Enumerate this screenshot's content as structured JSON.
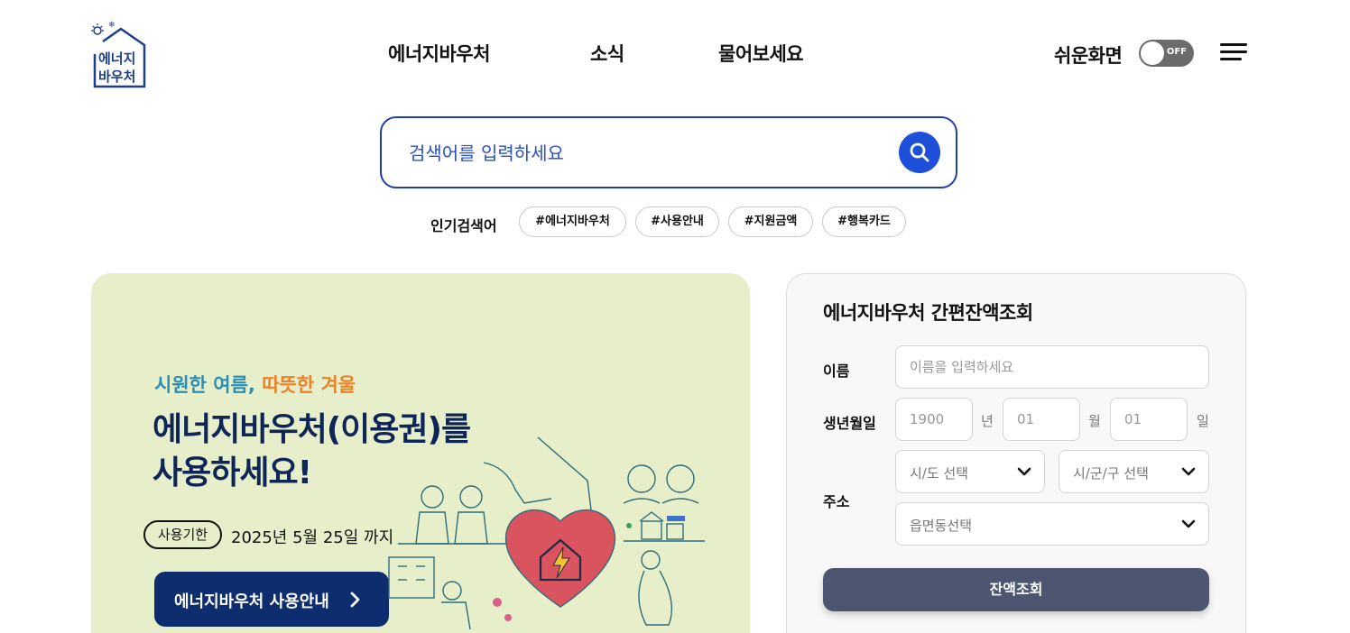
{
  "header": {
    "logo_text_line1": "에너지",
    "logo_text_line2": "바우처",
    "nav": [
      "에너지바우처",
      "소식",
      "물어보세요"
    ],
    "easy_view_label": "쉬운화면",
    "toggle_state": "OFF",
    "menu_icon": "hamburger-icon"
  },
  "search": {
    "placeholder": "검색어를 입력하세요",
    "button_icon": "search-icon",
    "popular_label": "인기검색어",
    "popular_tags": [
      "#에너지바우처",
      "#사용안내",
      "#지원금액",
      "#행복카드"
    ]
  },
  "banner": {
    "subtitle_part1": "시원한 여름,",
    "subtitle_part2": "따뜻한 겨울",
    "title_line1": "에너지바우처(이용권)를",
    "title_line2": "사용하세요!",
    "period_badge": "사용기한",
    "period_text": "2025년 5월 25일 까지",
    "guide_button": "에너지바우처 사용안내"
  },
  "balance": {
    "title": "에너지바우처 간편잔액조회",
    "name_label": "이름",
    "name_placeholder": "이름을 입력하세요",
    "birth_label": "생년월일",
    "year_placeholder": "1900",
    "year_unit": "년",
    "month_placeholder": "01",
    "month_unit": "월",
    "day_placeholder": "01",
    "day_unit": "일",
    "address_label": "주소",
    "sido_select": "시/도 선택",
    "sigungu_select": "시/군/구 선택",
    "emd_select": "읍면동선택",
    "submit_label": "잔액조회"
  },
  "colors": {
    "brand_blue": "#1e4fd8",
    "navy": "#0e2d6e",
    "banner_bg": "#e6efc9",
    "submit_bg": "#4c5670",
    "subtitle_blue": "#2a8fb8",
    "subtitle_orange": "#e8832a"
  }
}
